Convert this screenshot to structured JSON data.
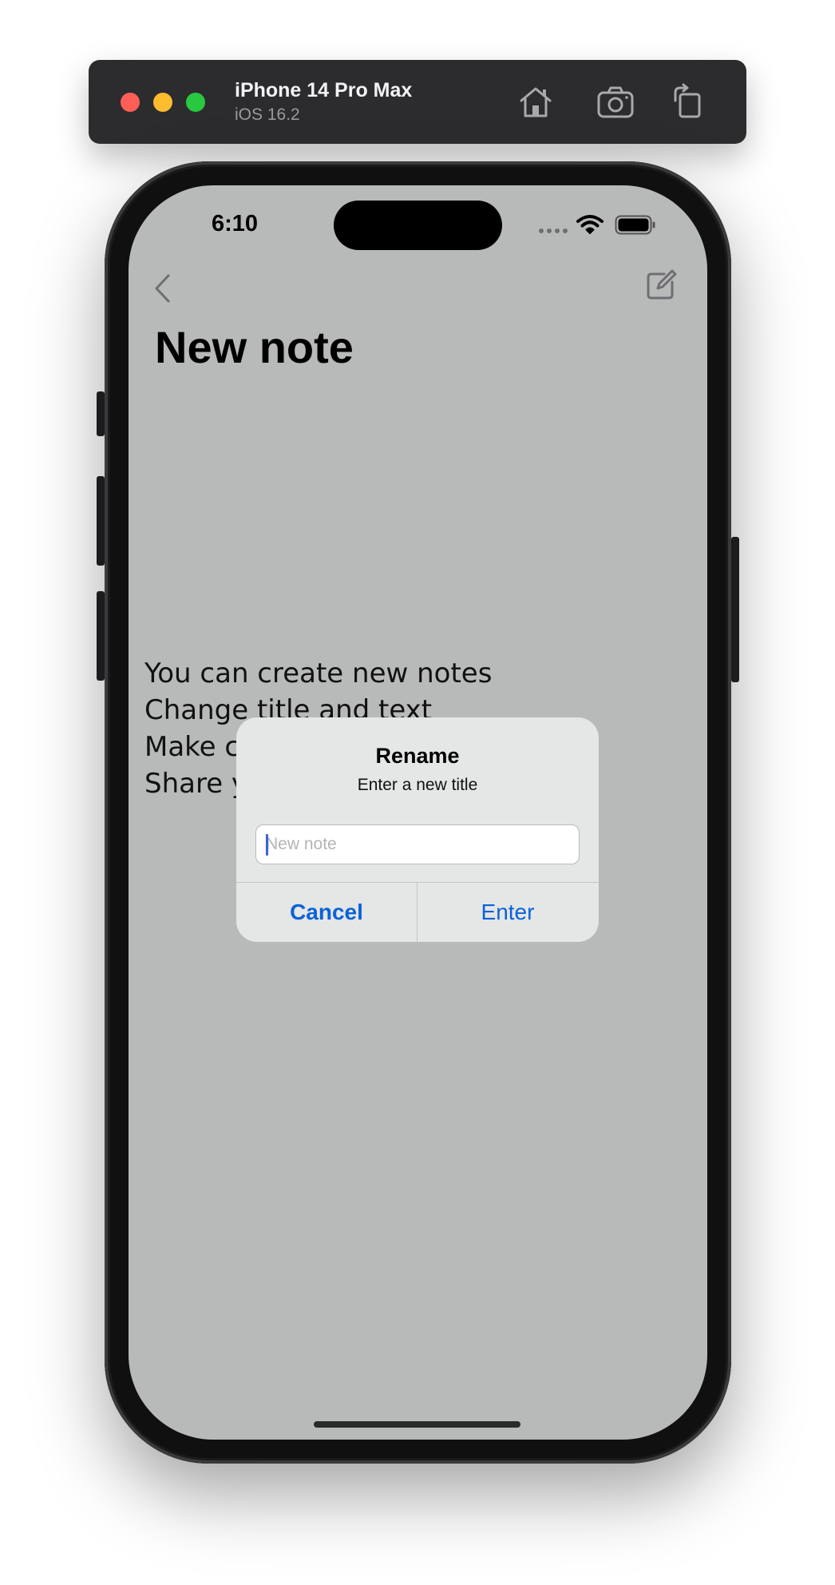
{
  "simulator": {
    "device_name": "iPhone 14 Pro Max",
    "os_version": "iOS 16.2",
    "icons": [
      "home-icon",
      "screenshot-icon",
      "rotate-icon"
    ]
  },
  "status_bar": {
    "time": "6:10",
    "icons": [
      "cellular-icon",
      "wifi-icon",
      "battery-icon"
    ]
  },
  "nav": {
    "title": "New note",
    "left_icon": "chevron-left-icon",
    "right_icon": "compose-icon"
  },
  "note": {
    "lines": [
      "You can create new notes",
      "Change title and text",
      "Make c",
      "Share y"
    ]
  },
  "alert": {
    "title": "Rename",
    "message": "Enter a new title",
    "input": {
      "value": "",
      "placeholder": "New note"
    },
    "cancel_label": "Cancel",
    "enter_label": "Enter"
  },
  "colors": {
    "dimmed_background": "#b8b9b9",
    "alert_background": "#e5e6e6",
    "action_blue": "#0a62d8",
    "toolbar_background": "#2c2c2e"
  }
}
